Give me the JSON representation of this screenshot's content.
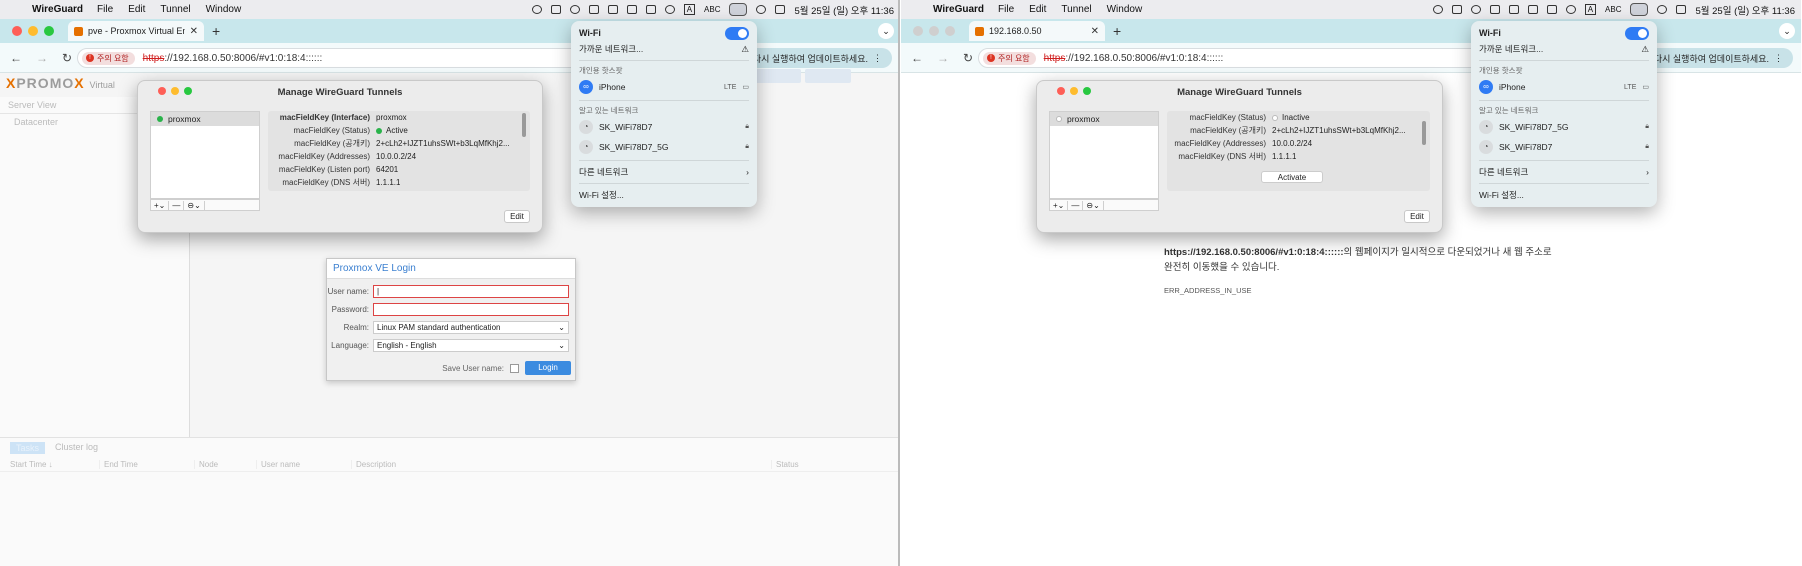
{
  "menubar": {
    "app": "WireGuard",
    "items": [
      "File",
      "Edit",
      "Tunnel",
      "Window"
    ],
    "lang_label": "A",
    "abc": "ABC",
    "clock": "5월 25일 (일) 오후 11:36"
  },
  "left": {
    "tab_title": "pve - Proxmox Virtual Environ...",
    "security_badge": "주의 요함",
    "url_proto": "https",
    "url_rest": "://192.168.0.50:8006/#v1:0:18:4::::::",
    "update_label": "다시 실행하여 업데이트하세요.",
    "proxmox": {
      "logo_a": "PRO",
      "logo_x": "X",
      "logo_b": "MO",
      "logo_c": "X",
      "logo_tag": "Virtual",
      "server_view": "Server View",
      "datacenter": "Datacenter",
      "bottom_tabs": [
        "Tasks",
        "Cluster log"
      ],
      "bottom_cols": [
        "Start Time ↓",
        "End Time",
        "Node",
        "User name",
        "Description",
        "Status"
      ]
    },
    "login": {
      "title": "Proxmox VE Login",
      "user_label": "User name:",
      "pass_label": "Password:",
      "realm_label": "Realm:",
      "realm_value": "Linux PAM standard authentication",
      "lang_label": "Language:",
      "lang_value": "English - English",
      "save_label": "Save User name:",
      "login_button": "Login"
    },
    "wg": {
      "title": "Manage WireGuard Tunnels",
      "tunnel": "proxmox",
      "details": [
        {
          "k": "macFieldKey (Interface)",
          "v": "proxmox"
        },
        {
          "k": "macFieldKey (Status)",
          "v": "Active"
        },
        {
          "k": "macFieldKey (공개키)",
          "v": "2+cLh2+IJZT1uhsSWt+b3LqMfKhj2..."
        },
        {
          "k": "macFieldKey (Addresses)",
          "v": "10.0.0.2/24"
        },
        {
          "k": "macFieldKey (Listen port)",
          "v": "64201"
        },
        {
          "k": "macFieldKey (DNS 서버)",
          "v": "1.1.1.1"
        }
      ],
      "edit": "Edit"
    }
  },
  "right": {
    "tab_title": "192.168.0.50",
    "security_badge": "주의 요함",
    "url_proto": "https",
    "url_rest": "://192.168.0.50:8006/#v1:0:18:4::::::",
    "update_label": "다시 실행하여 업데이트하세요.",
    "error": {
      "url": "https://192.168.0.50:8006/#v1:0:18:4::::::",
      "text": "의 웹페이지가 일시적으로 다운되었거나 새 웹 주소로 완전히 이동했을 수 있습니다.",
      "code": "ERR_ADDRESS_IN_USE"
    },
    "wg": {
      "title": "Manage WireGuard Tunnels",
      "tunnel": "proxmox",
      "details": [
        {
          "k": "macFieldKey (Status)",
          "v": "Inactive"
        },
        {
          "k": "macFieldKey (공개키)",
          "v": "2+cLh2+IJZT1uhsSWt+b3LqMfKhj2..."
        },
        {
          "k": "macFieldKey (Addresses)",
          "v": "10.0.0.2/24"
        },
        {
          "k": "macFieldKey (DNS 서버)",
          "v": "1.1.1.1"
        }
      ],
      "activate": "Activate",
      "edit": "Edit"
    }
  },
  "wifi": {
    "title": "Wi-Fi",
    "nearby": "가까운 네트워크...",
    "hotspot_section": "개인용 핫스팟",
    "hotspot": "iPhone",
    "hotspot_lte": "LTE",
    "known_section": "알고 있는 네트워크",
    "known": [
      "SK_WiFi78D7",
      "SK_WiFi78D7_5G"
    ],
    "known_right": [
      "SK_WiFi78D7_5G",
      "SK_WiFi78D7"
    ],
    "other": "다른 네트워크",
    "settings": "Wi-Fi 설정..."
  }
}
